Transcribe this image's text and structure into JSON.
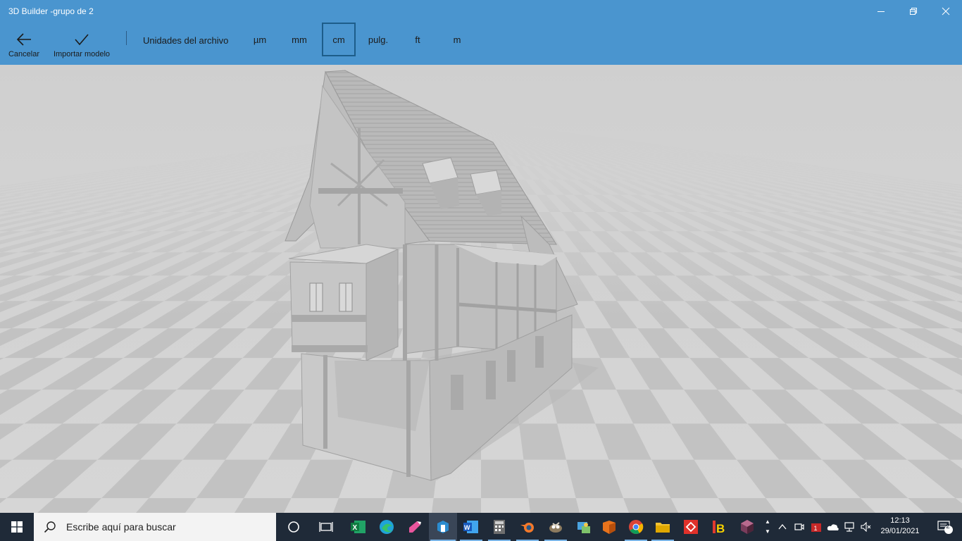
{
  "window": {
    "title": "3D Builder -grupo de 2"
  },
  "commands": {
    "cancel_label": "Cancelar",
    "import_label": "Importar modelo"
  },
  "units": {
    "label": "Unidades del archivo",
    "options": [
      "µm",
      "mm",
      "cm",
      "pulg.",
      "ft",
      "m"
    ],
    "selected": "cm"
  },
  "viewport": {
    "content": "house-3d-model",
    "background": "checkerboard-floor"
  },
  "taskbar": {
    "search_placeholder": "Escribe aquí para buscar",
    "apps": [
      "cortana",
      "task-view",
      "excel",
      "edge",
      "paint-3d",
      "3d-builder",
      "word",
      "calculator",
      "blender",
      "gimp",
      "control-panel",
      "app-orange",
      "chrome",
      "file-explorer",
      "anydesk",
      "app-ib",
      "app-cube"
    ],
    "active_app": "3d-builder",
    "time": "12:13",
    "date": "29/01/2021",
    "notifications": "2"
  },
  "colors": {
    "accent": "#4a95cf",
    "taskbar": "#1f2a38",
    "selected_border": "#1d5d8a"
  }
}
